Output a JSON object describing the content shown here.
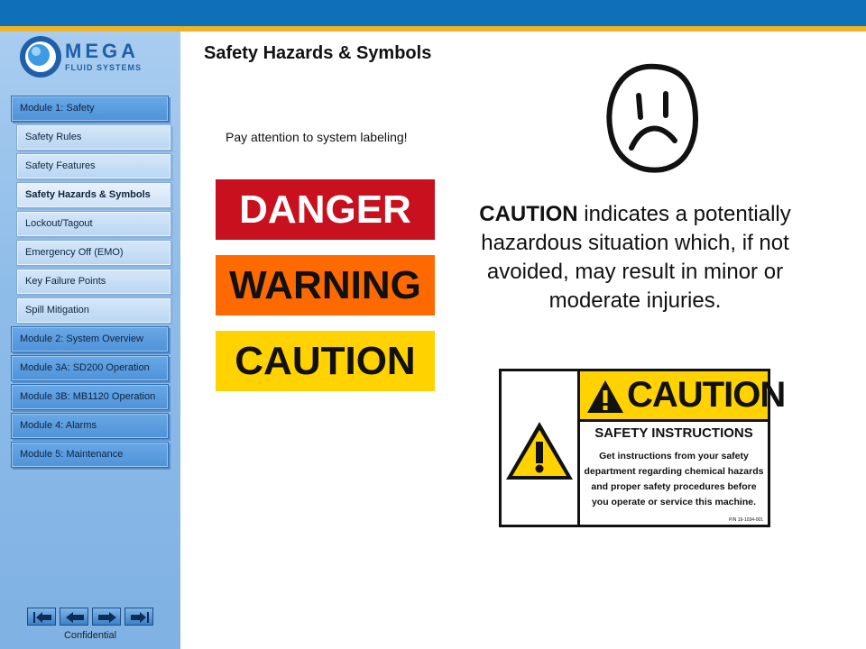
{
  "logo": {
    "name": "MEGA",
    "tagline": "FLUID SYSTEMS"
  },
  "colors": {
    "topbar": "#0f6fb8",
    "topbar_stripe": "#f1b323",
    "danger": "#c8101f",
    "warning": "#ff6a00",
    "caution": "#ffd200"
  },
  "sidebar": {
    "items": [
      {
        "label": "Module 1: Safety",
        "kind": "module"
      },
      {
        "label": "Safety Rules",
        "kind": "sub"
      },
      {
        "label": "Safety Features",
        "kind": "sub"
      },
      {
        "label": "Safety Hazards & Symbols",
        "kind": "sub",
        "active": true
      },
      {
        "label": "Lockout/Tagout",
        "kind": "sub"
      },
      {
        "label": "Emergency Off (EMO)",
        "kind": "sub"
      },
      {
        "label": "Key Failure Points",
        "kind": "sub"
      },
      {
        "label": "Spill Mitigation",
        "kind": "sub"
      },
      {
        "label": "Module 2: System Overview",
        "kind": "module"
      },
      {
        "label": "Module 3A: SD200 Operation",
        "kind": "module"
      },
      {
        "label": "Module 3B: MB1120 Operation",
        "kind": "module"
      },
      {
        "label": "Module 4: Alarms",
        "kind": "module"
      },
      {
        "label": "Module 5: Maintenance",
        "kind": "module"
      }
    ],
    "footer": "Confidential",
    "nav_icons": [
      "first-page-icon",
      "previous-page-icon",
      "next-page-icon",
      "last-page-icon"
    ]
  },
  "slide": {
    "title": "Safety Hazards & Symbols",
    "note": "Pay attention to system labeling!",
    "signs": {
      "danger": "DANGER",
      "warning": "WARNING",
      "caution": "CAUTION"
    },
    "face_icon": "sad-face-icon",
    "description_keyword": "CAUTION",
    "description_rest": "indicates a potentially hazardous situation which, if not avoided, may result in minor or moderate injuries.",
    "label": {
      "header": "CAUTION",
      "subheader": "SAFETY INSTRUCTIONS",
      "body": "Get instructions from your safety department regarding chemical hazards and proper safety procedures before you operate or service this machine.",
      "part_number": "P/N 19-1034-001"
    }
  }
}
